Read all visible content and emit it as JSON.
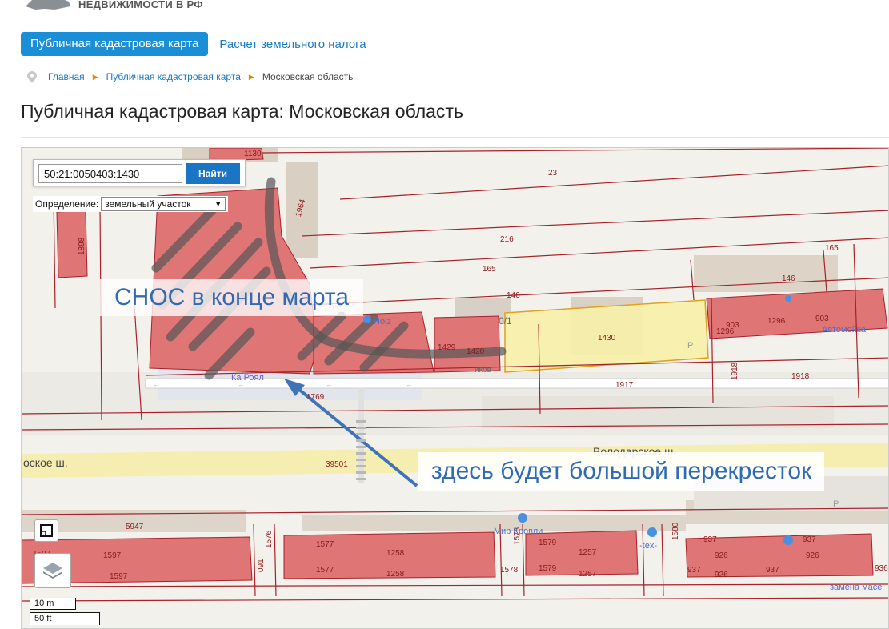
{
  "header": {
    "site_title": "НЕДВИЖИМОСТИ В РФ"
  },
  "nav": {
    "active_tab": "Публичная кадастровая карта",
    "tab_2": "Расчет земельного налога"
  },
  "breadcrumb": {
    "home": "Главная",
    "section": "Публичная кадастровая карта",
    "current": "Московская область"
  },
  "page": {
    "title": "Публичная кадастровая карта: Московская область"
  },
  "map": {
    "search_value": "50:21:0050403:1430",
    "search_button": "Найти",
    "definition_label": "Определение:",
    "definition_value": "земельный участок",
    "annotation_demolition": "СНОС в конце марта",
    "annotation_intersection": "здесь будет большой перекресток",
    "scale_m": "10 m",
    "scale_ft": "50 ft",
    "labels": {
      "l1130": "1130",
      "l23": "23",
      "l1964": "1964",
      "l1898": "1898",
      "l216": "216",
      "l165a": "165",
      "l165b": "165",
      "l146a": "146",
      "l146b": "146",
      "l1296a": "1296",
      "l1296b": "1296",
      "l903a": "903",
      "l903b": "903",
      "l1430": "1430",
      "l1429": "1429",
      "l1420": "1420",
      "l01": "0/1",
      "l1918a": "1918",
      "l1918b": "1918",
      "l1917": "1917",
      "l1769": "1769",
      "l39501": "39501",
      "l5947": "5947",
      "l1597a": "1597",
      "l1597b": "1597",
      "l1576": "1576",
      "l1577a": "1577",
      "l1577b": "1577",
      "l1258a": "1258",
      "l1258b": "1258",
      "l1578a": "1578",
      "l1578b": "1578",
      "l1579a": "1579",
      "l1579b": "1579",
      "l1257a": "1257",
      "l1257b": "1257",
      "l1580": "1580",
      "l937a": "937",
      "l937b": "937",
      "l937c": "937",
      "l937d": "937",
      "l926a": "926",
      "l926b": "926",
      "l926c": "926",
      "l936": "936",
      "l091": "091",
      "road_volodarskoe": "Володарское ш.",
      "road_left": "оское ш.",
      "poi_holz": "Holz",
      "poi_korol": "Ка Роял",
      "poi_avtomoika": "Автомойка",
      "poi_mir_krovli": "Мир Кровли",
      "poi_tex": "-tex-",
      "poi_zamena": "замена масе",
      "poi_p1": "P",
      "poi_p2": "P",
      "poi_ikov": "иков"
    }
  },
  "colors": {
    "accent": "#1a8fd8",
    "parcel_red": "#e07575",
    "selected_yellow": "#f7f0a8",
    "boundary": "#a8202a",
    "annotation": "#2f6ab5"
  }
}
